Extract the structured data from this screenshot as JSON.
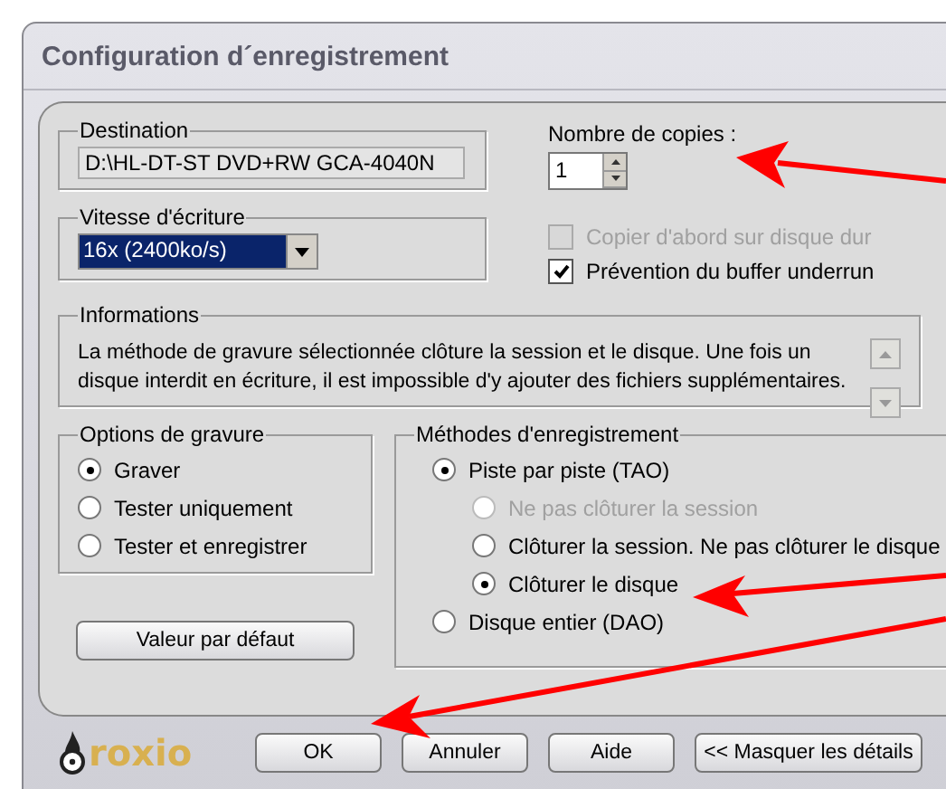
{
  "window": {
    "title": "Configuration d´enregistrement"
  },
  "destination": {
    "label": "Destination",
    "value": "D:\\HL-DT-ST DVD+RW GCA-4040N"
  },
  "write_speed": {
    "label": "Vitesse d'écriture",
    "value": "16x (2400ko/s)"
  },
  "copies": {
    "label": "Nombre de copies :",
    "value": "1"
  },
  "checkboxes": [
    {
      "label": "Copier d'abord sur disque dur",
      "checked": false,
      "disabled": true
    },
    {
      "label": "Prévention du buffer underrun",
      "checked": true,
      "disabled": false
    }
  ],
  "informations": {
    "label": "Informations",
    "text": "La méthode de gravure sélectionnée clôture la session et le disque. Une fois un disque interdit en écriture, il est impossible d'y ajouter des fichiers supplémentaires."
  },
  "burn_options": {
    "label": "Options de gravure",
    "options": [
      {
        "label": "Graver",
        "selected": true
      },
      {
        "label": "Tester uniquement",
        "selected": false
      },
      {
        "label": "Tester et enregistrer",
        "selected": false
      }
    ]
  },
  "default_button": "Valeur par défaut",
  "record_methods": {
    "label": "Méthodes d'enregistrement",
    "options": [
      {
        "label": "Piste par piste (TAO)",
        "selected": true,
        "disabled": false,
        "children": [
          {
            "label": "Ne pas clôturer la session",
            "selected": false,
            "disabled": true
          },
          {
            "label": "Clôturer la session. Ne pas clôturer le disque",
            "selected": false,
            "disabled": false
          },
          {
            "label": "Clôturer le disque",
            "selected": true,
            "disabled": false
          }
        ]
      },
      {
        "label": "Disque entier (DAO)",
        "selected": false,
        "disabled": false
      }
    ]
  },
  "logo": {
    "text": "roxio"
  },
  "buttons": [
    "OK",
    "Annuler",
    "Aide",
    "<< Masquer les détails"
  ]
}
